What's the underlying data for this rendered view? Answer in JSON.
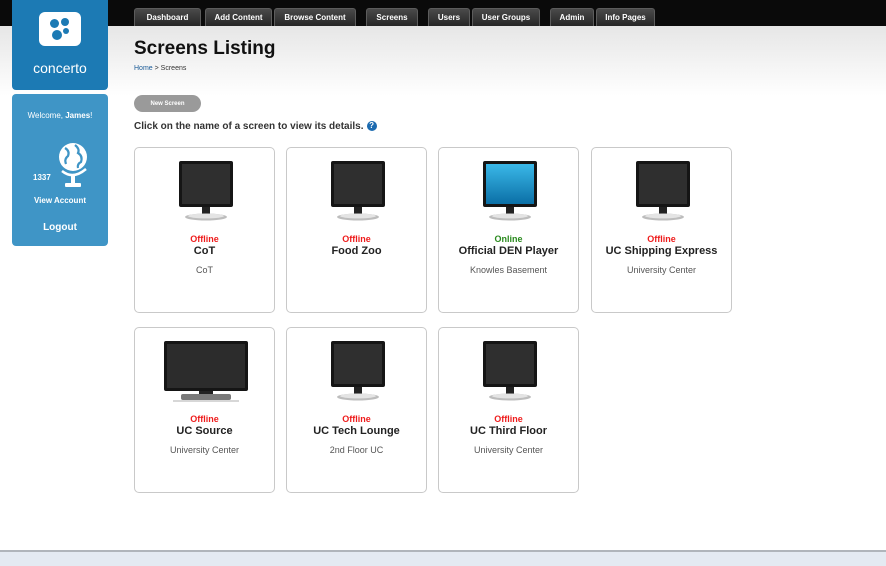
{
  "app": {
    "logo_text": "concerto"
  },
  "nav": [
    "Dashboard",
    "Add Content",
    "Browse Content",
    "Screens",
    "Users",
    "User Groups",
    "Admin",
    "Info Pages"
  ],
  "user": {
    "welcome_prefix": "Welcome, ",
    "name": "James",
    "welcome_suffix": "!",
    "points": "1337",
    "view_account": "View Account",
    "logout": "Logout"
  },
  "page": {
    "title": "Screens Listing",
    "breadcrumb_home": "Home",
    "breadcrumb_sep": " > ",
    "breadcrumb_current": "Screens",
    "new_screen": "New Screen",
    "instructions": "Click on the name of a screen to view its details.",
    "help_icon": "?"
  },
  "colors": {
    "offline": "#ee1c1c",
    "online": "#2a8a1e",
    "accent": "#1c7ab4"
  },
  "screens": [
    {
      "status": "Offline",
      "name": "CoT",
      "location": "CoT",
      "monitor": "standard"
    },
    {
      "status": "Offline",
      "name": "Food Zoo",
      "location": "",
      "monitor": "standard"
    },
    {
      "status": "Online",
      "name": "Official DEN Player",
      "location": "Knowles Basement",
      "monitor": "standard-on"
    },
    {
      "status": "Offline",
      "name": "UC Shipping Express",
      "location": "University Center",
      "monitor": "standard"
    },
    {
      "status": "Offline",
      "name": "UC Source",
      "location": "University Center",
      "monitor": "widescreen"
    },
    {
      "status": "Offline",
      "name": "UC Tech Lounge",
      "location": "2nd Floor UC",
      "monitor": "standard"
    },
    {
      "status": "Offline",
      "name": "UC Third Floor",
      "location": "University Center",
      "monitor": "standard"
    }
  ]
}
